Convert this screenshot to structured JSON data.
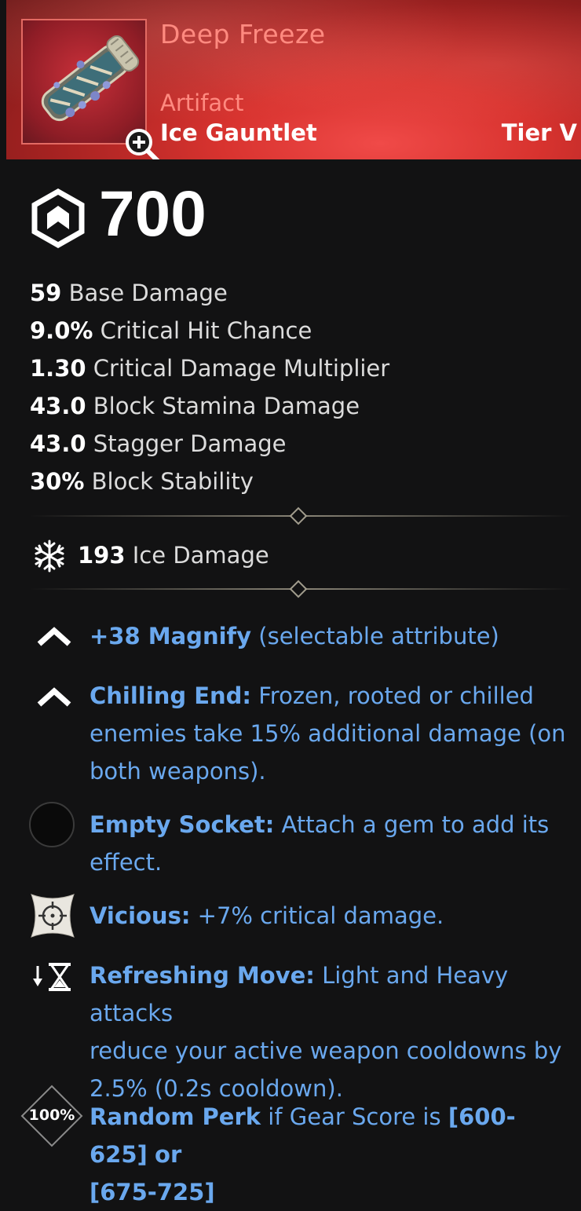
{
  "item": {
    "name": "Deep Freeze",
    "rarity": "Artifact",
    "type": "Ice Gauntlet",
    "tier": "Tier V"
  },
  "gear_score": "700",
  "stats": [
    {
      "value": "59",
      "label": "Base Damage"
    },
    {
      "value": "9.0%",
      "label": "Critical Hit Chance"
    },
    {
      "value": "1.30",
      "label": "Critical Damage Multiplier"
    },
    {
      "value": "43.0",
      "label": "Block Stamina Damage"
    },
    {
      "value": "43.0",
      "label": "Stagger Damage"
    },
    {
      "value": "30%",
      "label": "Block Stability"
    }
  ],
  "elemental": {
    "value": "193",
    "label": "Ice Damage",
    "icon": "snowflake-icon"
  },
  "perks": [
    {
      "icon": "chevron-up-icon",
      "name": "+38 Magnify",
      "text": "(selectable attribute)"
    },
    {
      "icon": "chevron-up-icon",
      "name": "Chilling End:",
      "text_line1": "Frozen, rooted or chilled",
      "text_line2": "enemies take 15% additional damage (on",
      "text_line3": "both weapons)."
    },
    {
      "icon": "empty-socket-icon",
      "name": "Empty Socket:",
      "text_line1": "Attach a gem to add its",
      "text_line2": "effect."
    },
    {
      "icon": "crosshair-icon",
      "name": "Vicious:",
      "text": "+7% critical damage."
    },
    {
      "icon": "hourglass-icon",
      "name": "Refreshing Move:",
      "text_line1": "Light and Heavy attacks",
      "text_line2": "reduce your active weapon cooldowns by",
      "text_line3": "2.5% (0.2s cooldown)."
    },
    {
      "icon": "random-perk-icon",
      "badge": "100%",
      "name": "Random Perk",
      "text_a": "if Gear Score is",
      "range1": "[600-625]",
      "text_b": "or",
      "range2": "[675-725]"
    }
  ],
  "colors": {
    "header_red": "#d8332f",
    "name_salmon": "#ff8a80",
    "perk_blue": "#6aa8ee",
    "background": "#121213"
  }
}
